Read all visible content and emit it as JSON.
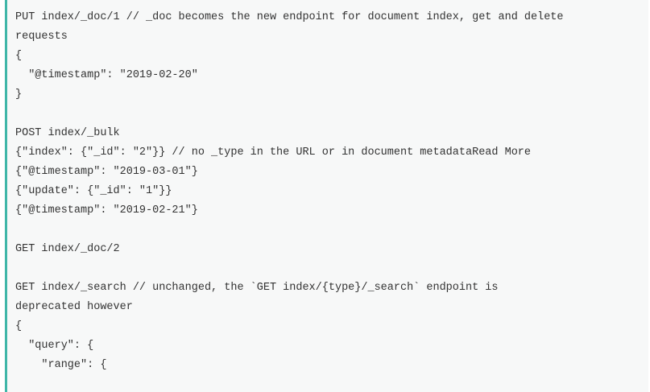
{
  "code_block": {
    "accent_color": "#3fb6a8",
    "background_color": "#f7f8f8",
    "lines": [
      "PUT index/_doc/1 // _doc becomes the new endpoint for document index, get and delete",
      "requests",
      "{",
      "  \"@timestamp\": \"2019-02-20\"",
      "}",
      "",
      "POST index/_bulk",
      "{\"index\": {\"_id\": \"2\"}} // no _type in the URL or in document metadataRead More",
      "{\"@timestamp\": \"2019-03-01\"}",
      "{\"update\": {\"_id\": \"1\"}}",
      "{\"@timestamp\": \"2019-02-21\"}",
      "",
      "GET index/_doc/2",
      "",
      "GET index/_search // unchanged, the `GET index/{type}/_search` endpoint is",
      "deprecated however",
      "{",
      "  \"query\": {",
      "    \"range\": {"
    ]
  }
}
